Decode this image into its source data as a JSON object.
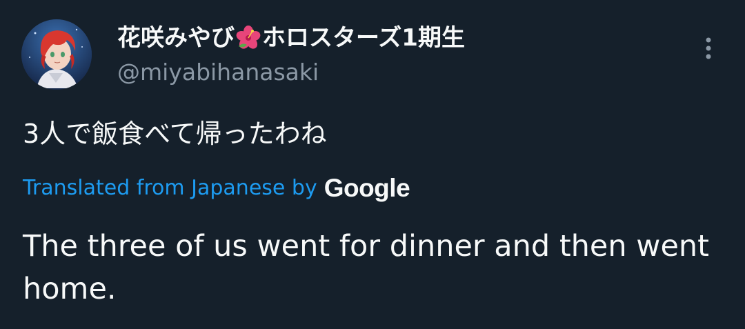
{
  "tweet": {
    "display_name_prefix": "花咲みやび",
    "display_name_emoji": "hibiscus-flower-icon",
    "display_name_suffix": "ホロスターズ1期生",
    "handle": "@miyabihanasaki",
    "original_text": "3人で飯食べて帰ったわね",
    "translated_label": "Translated from Japanese by",
    "translator_brand": "Google",
    "translation": "The three of us went for dinner and then went home.",
    "more_icon": "more-vertical-icon"
  },
  "colors": {
    "background": "#15202b",
    "primary_text": "#f7f9f9",
    "secondary_text": "#8b98a5",
    "link": "#1d9bf0"
  }
}
